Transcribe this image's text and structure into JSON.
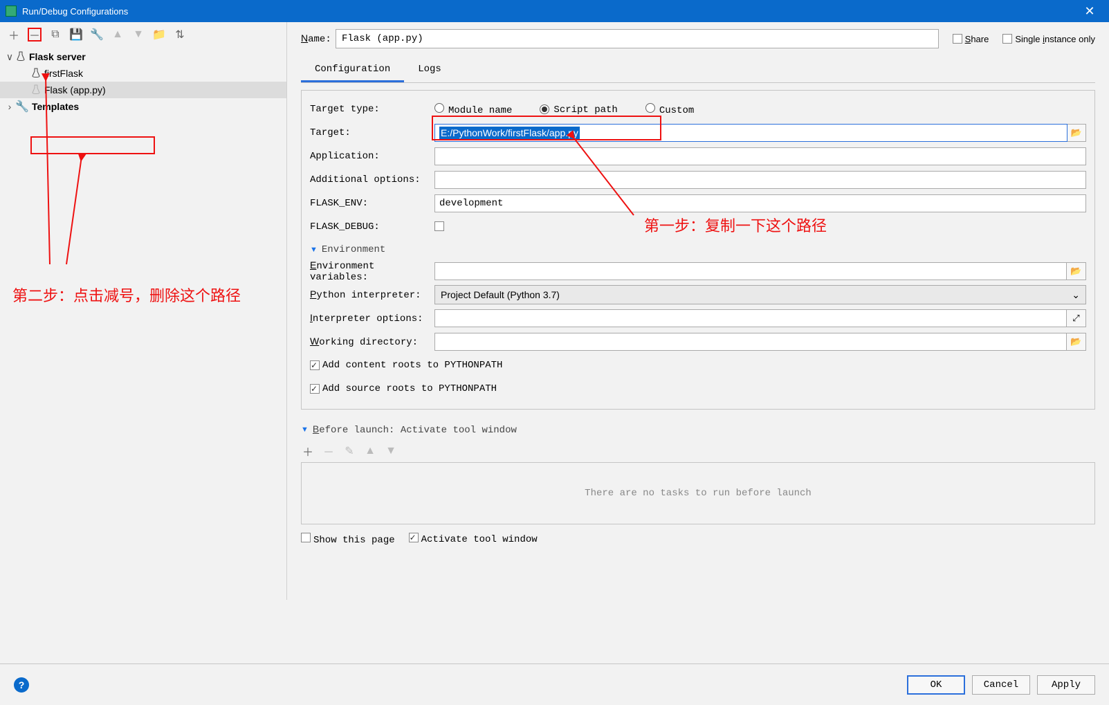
{
  "window": {
    "title": "Run/Debug Configurations"
  },
  "sidebar": {
    "tree": [
      {
        "label": "Flask server",
        "bold": true
      },
      {
        "label": "firstFlask"
      },
      {
        "label": "Flask (app.py)"
      },
      {
        "label": "Templates",
        "bold": true
      }
    ]
  },
  "topbar": {
    "name_label": "Name:",
    "name_value": "Flask (app.py)",
    "share": "Share",
    "single": "Single instance only"
  },
  "tabs": {
    "config": "Configuration",
    "logs": "Logs"
  },
  "config": {
    "target_type_label": "Target type:",
    "target_type": {
      "module": "Module name",
      "script": "Script path",
      "custom": "Custom"
    },
    "target_label": "Target:",
    "target_value": "E:/PythonWork/firstFlask/app.py",
    "application_label": "Application:",
    "application_value": "",
    "addopts_label": "Additional options:",
    "addopts_value": "",
    "flaskenv_label": "FLASK_ENV:",
    "flaskenv_value": "development",
    "flaskdebug_label": "FLASK_DEBUG:",
    "env_section": "Environment",
    "envvars_label": "Environment variables:",
    "interpreter_label": "Python interpreter:",
    "interpreter_value": "Project Default (Python 3.7)",
    "interp_opts_label": "Interpreter options:",
    "workdir_label": "Working directory:",
    "add_content": "Add content roots to PYTHONPATH",
    "add_source": "Add source roots to PYTHONPATH"
  },
  "before": {
    "header": "Before launch: Activate tool window",
    "empty": "There are no tasks to run before launch",
    "show_page": "Show this page",
    "activate": "Activate tool window"
  },
  "buttons": {
    "ok": "OK",
    "cancel": "Cancel",
    "apply": "Apply"
  },
  "annotations": {
    "step1": "第一步：复制一下这个路径",
    "step2": "第二步：点击减号，删除这个路径"
  }
}
